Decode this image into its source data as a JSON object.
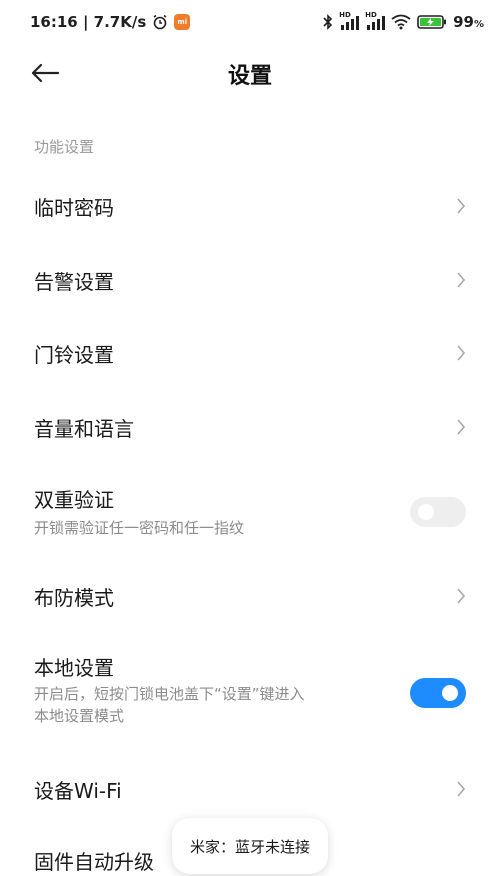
{
  "status_bar": {
    "time_speed": "16:16 | 7.7K/s",
    "mi_badge": "mi",
    "hd1": "HD",
    "hd2": "HD",
    "battery_pct": "99",
    "battery_unit": "%",
    "icons": [
      "alarm-clock-icon",
      "mi-app-icon",
      "bluetooth-icon",
      "signal-icon",
      "signal-icon",
      "wifi-icon",
      "battery-charging-icon"
    ]
  },
  "header": {
    "title": "设置",
    "back_icon": "back-arrow-icon"
  },
  "section": {
    "label": "功能设置"
  },
  "rows": [
    {
      "title": "临时密码",
      "control": "chevron"
    },
    {
      "title": "告警设置",
      "control": "chevron"
    },
    {
      "title": "门铃设置",
      "control": "chevron"
    },
    {
      "title": "音量和语言",
      "control": "chevron"
    },
    {
      "title": "双重验证",
      "subtitle": "开锁需验证任一密码和任一指纹",
      "control": "toggle",
      "toggle_state": "off"
    },
    {
      "title": "布防模式",
      "control": "chevron"
    },
    {
      "title": "本地设置",
      "subtitle_line1": "开启后，短按门锁电池盖下“设置”键进入",
      "subtitle_line2": "本地设置模式",
      "control": "toggle",
      "toggle_state": "on"
    },
    {
      "title": "设备Wi-Fi",
      "control": "chevron"
    },
    {
      "title": "固件自动升级"
    }
  ],
  "toast": {
    "text": "米家：蓝牙未连接"
  },
  "colors": {
    "accent": "#1e8cff",
    "toggle_off": "#eeeeee",
    "section_label": "#9a9a9a",
    "subtitle": "#8c8c8c",
    "mi_badge": "#f07b2a"
  }
}
